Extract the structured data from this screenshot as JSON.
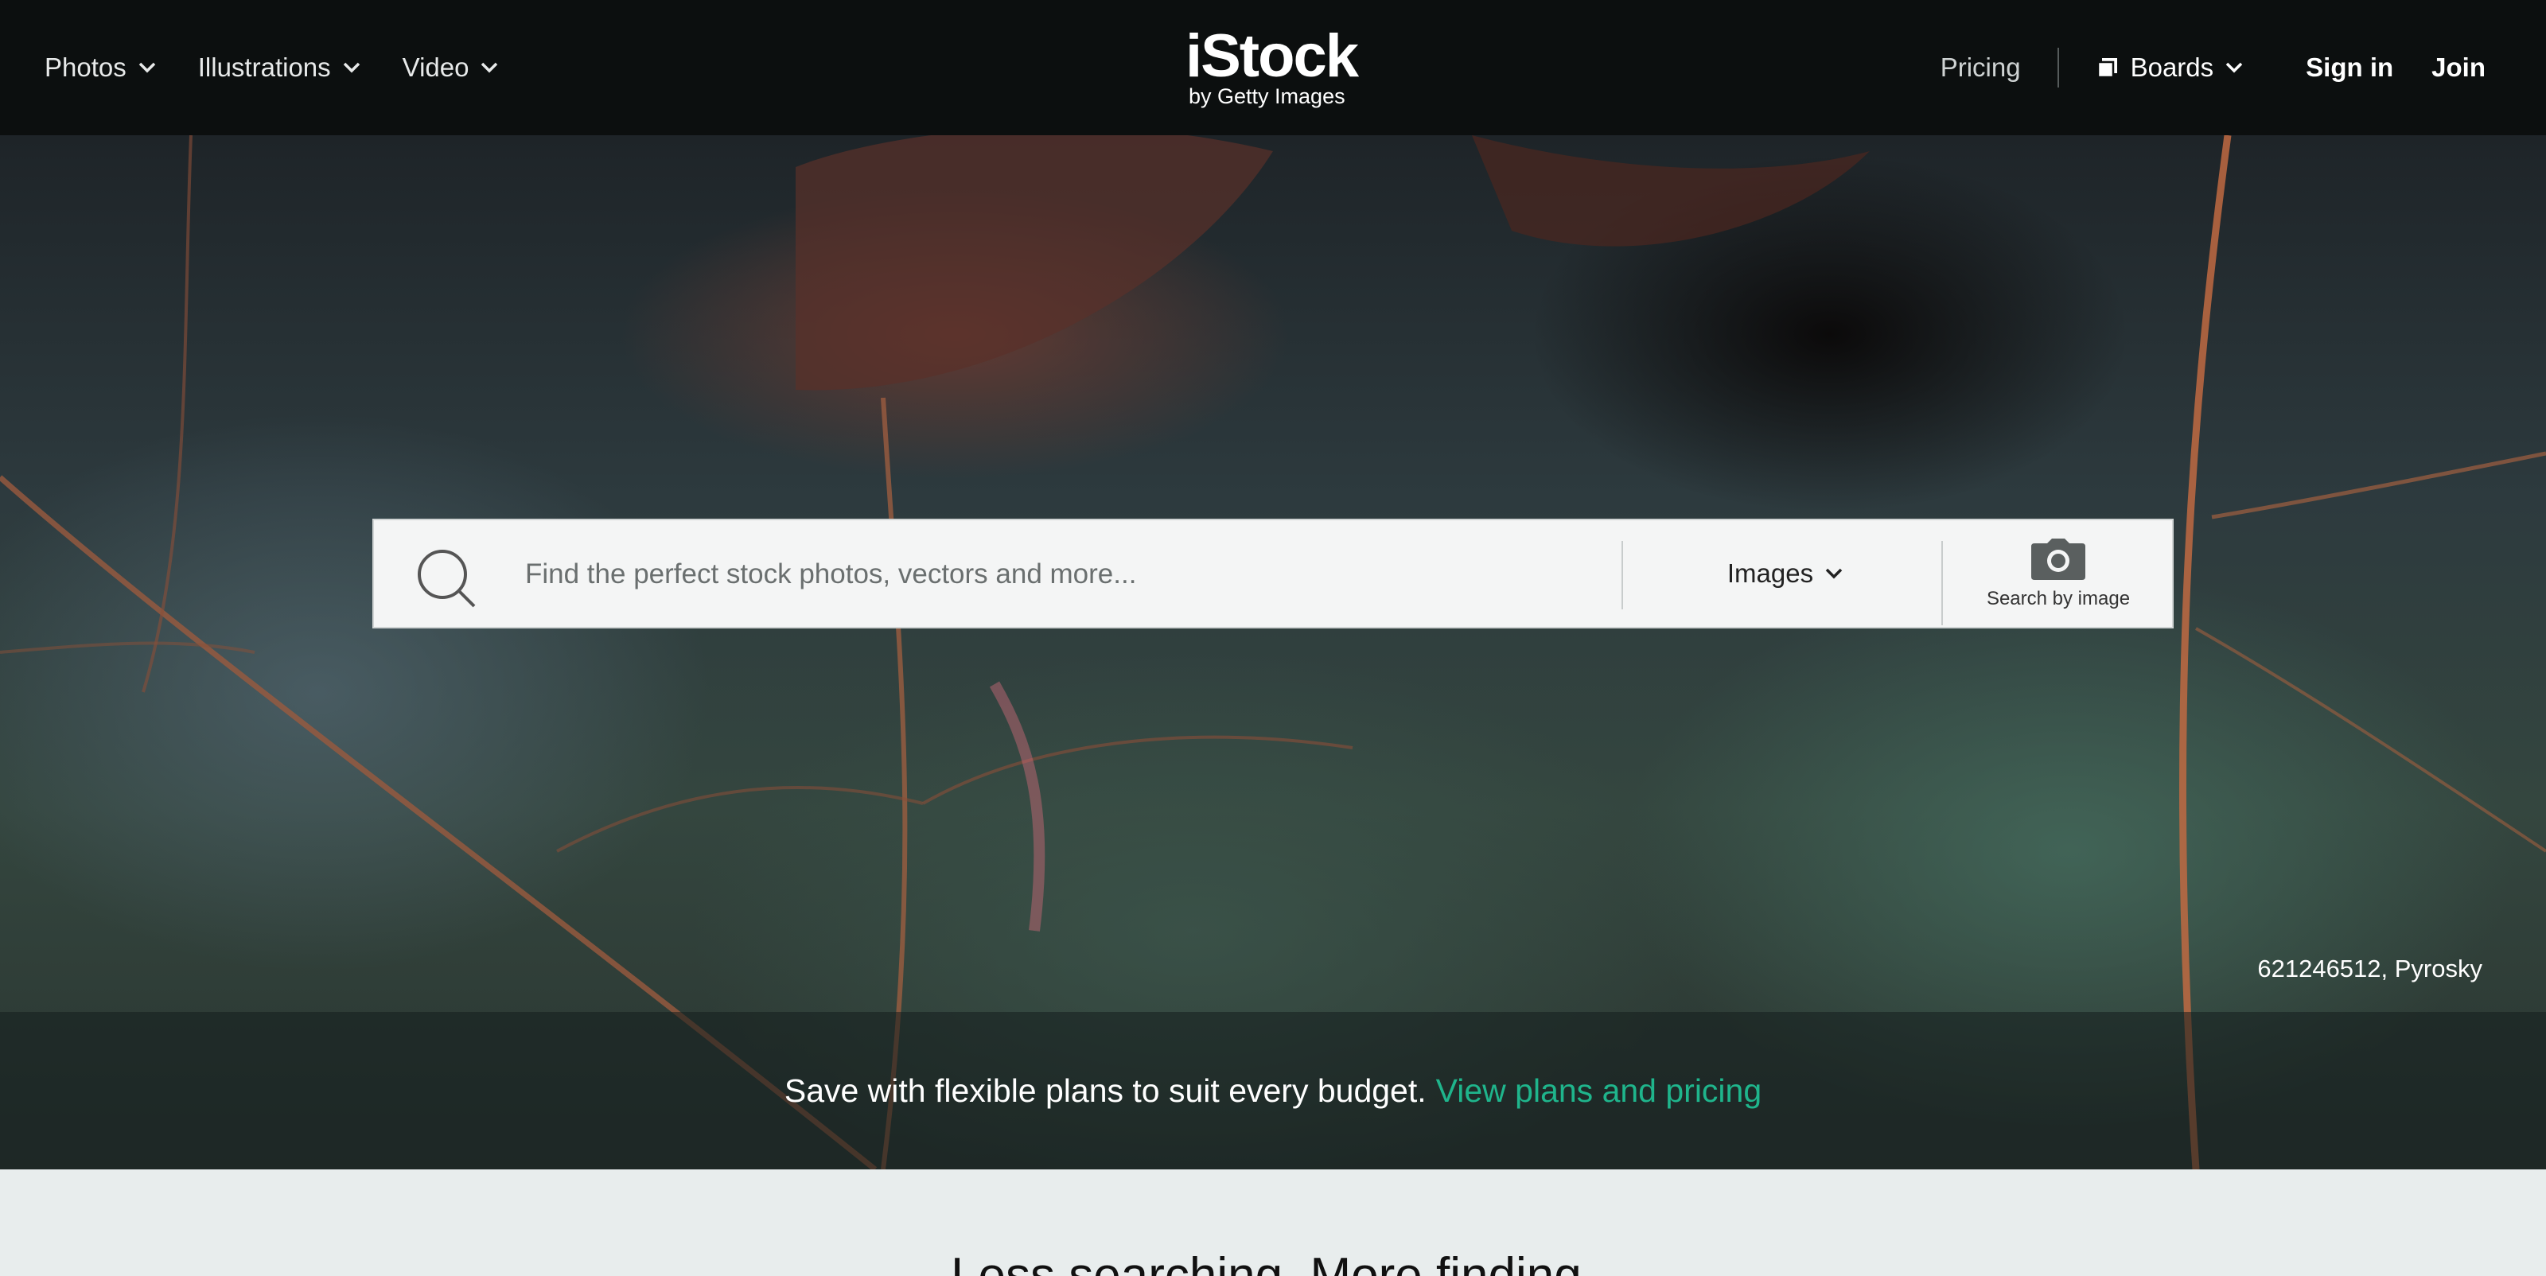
{
  "nav": {
    "menus": [
      {
        "label": "Photos"
      },
      {
        "label": "Illustrations"
      },
      {
        "label": "Video"
      }
    ],
    "logo_main": "iStock",
    "logo_sub": "by Getty Images",
    "pricing_label": "Pricing",
    "boards_label": "Boards",
    "sign_in_label": "Sign in",
    "join_label": "Join"
  },
  "search": {
    "placeholder": "Find the perfect stock photos, vectors and more...",
    "value": "",
    "type_selected": "Images",
    "by_image_label": "Search by image"
  },
  "hero": {
    "credit": "621246512, Pyrosky"
  },
  "banner": {
    "text": "Save with flexible plans to suit every budget.",
    "link": "View plans and pricing",
    "link_color": "#1fb58c"
  },
  "section": {
    "heading": "Less searching. More finding."
  }
}
